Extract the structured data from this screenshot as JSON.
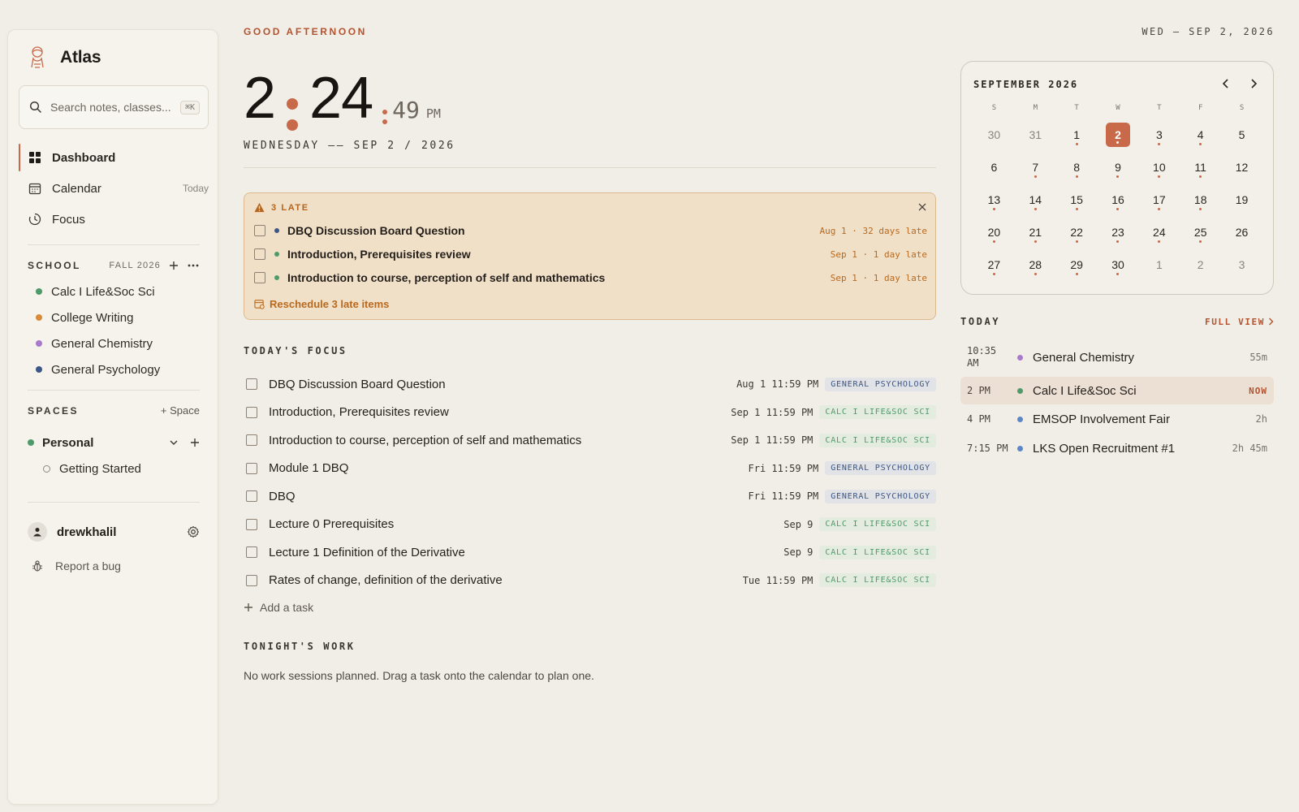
{
  "app": {
    "name": "Atlas"
  },
  "colors": {
    "accent": "#c8694a",
    "calc": "#4f9a6a",
    "writing": "#d88a3a",
    "chemistry": "#a97acc",
    "psychology": "#3c5685",
    "event_blue": "#5b86c8"
  },
  "sidebar": {
    "search": {
      "text": "Search notes, classes...",
      "shortcut": "⌘K"
    },
    "nav": [
      {
        "label": "Dashboard",
        "icon": "grid-icon",
        "active": true
      },
      {
        "label": "Calendar",
        "icon": "calendar-icon",
        "aux": "Today"
      },
      {
        "label": "Focus",
        "icon": "clock-icon"
      }
    ],
    "school": {
      "title": "SCHOOL",
      "term": "FALL 2026",
      "classes": [
        {
          "label": "Calc I Life&Soc Sci",
          "color": "#4f9a6a"
        },
        {
          "label": "College Writing",
          "color": "#d88a3a"
        },
        {
          "label": "General Chemistry",
          "color": "#a97acc"
        },
        {
          "label": "General Psychology",
          "color": "#3c5685"
        }
      ]
    },
    "spaces": {
      "title": "SPACES",
      "add_label": "+ Space",
      "space": {
        "label": "Personal",
        "color": "#4f9a6a"
      },
      "children": [
        {
          "label": "Getting Started"
        }
      ]
    },
    "user": {
      "name": "drewkhalil"
    },
    "report_bug": "Report a bug"
  },
  "main": {
    "greeting": "GOOD AFTERNOON",
    "clock": {
      "hour": "2",
      "minute": "24",
      "second": "49",
      "ampm": "PM"
    },
    "date_line": "WEDNESDAY —— SEP 2 / 2026",
    "late": {
      "header": "3 LATE",
      "items": [
        {
          "title": "DBQ Discussion Board Question",
          "due": "Aug 1 · 32 days late",
          "color": "#3c5685"
        },
        {
          "title": "Introduction, Prerequisites review",
          "due": "Sep 1 · 1 day late",
          "color": "#4f9a6a"
        },
        {
          "title": "Introduction to course, perception of self and mathematics",
          "due": "Sep 1 · 1 day late",
          "color": "#4f9a6a"
        }
      ],
      "reschedule": "Reschedule 3 late items"
    },
    "focus": {
      "title": "TODAY'S FOCUS",
      "tasks": [
        {
          "title": "DBQ Discussion Board Question",
          "due": "Aug 1 11:59 PM",
          "tag": "GENERAL PSYCHOLOGY",
          "kind": "psych"
        },
        {
          "title": "Introduction, Prerequisites review",
          "due": "Sep 1 11:59 PM",
          "tag": "CALC I LIFE&SOC SCI",
          "kind": "calc"
        },
        {
          "title": "Introduction to course, perception of self and mathematics",
          "due": "Sep 1 11:59 PM",
          "tag": "CALC I LIFE&SOC SCI",
          "kind": "calc"
        },
        {
          "title": "Module 1 DBQ",
          "due": "Fri 11:59 PM",
          "tag": "GENERAL PSYCHOLOGY",
          "kind": "psych"
        },
        {
          "title": "DBQ",
          "due": "Fri 11:59 PM",
          "tag": "GENERAL PSYCHOLOGY",
          "kind": "psych"
        },
        {
          "title": "Lecture 0 Prerequisites",
          "due": "Sep 9",
          "tag": "CALC I LIFE&SOC SCI",
          "kind": "calc"
        },
        {
          "title": "Lecture 1 Definition of the Derivative",
          "due": "Sep 9",
          "tag": "CALC I LIFE&SOC SCI",
          "kind": "calc"
        },
        {
          "title": "Rates of change, definition of the derivative",
          "due": "Tue 11:59 PM",
          "tag": "CALC I LIFE&SOC SCI",
          "kind": "calc"
        }
      ],
      "add_task": "Add a task"
    },
    "tonight": {
      "title": "TONIGHT'S WORK",
      "empty": "No work sessions planned. Drag a task onto the calendar to plan one."
    }
  },
  "right": {
    "date": "WED — SEP 2, 2026",
    "calendar": {
      "title": "SEPTEMBER 2026",
      "weekdays": [
        "S",
        "M",
        "T",
        "W",
        "T",
        "F",
        "S"
      ],
      "days": [
        {
          "n": "30",
          "muted": true,
          "ev": false
        },
        {
          "n": "31",
          "muted": true,
          "ev": false
        },
        {
          "n": "1",
          "ev": true
        },
        {
          "n": "2",
          "ev": true,
          "selected": true
        },
        {
          "n": "3",
          "ev": true
        },
        {
          "n": "4",
          "ev": true
        },
        {
          "n": "5",
          "ev": false
        },
        {
          "n": "6",
          "ev": false
        },
        {
          "n": "7",
          "ev": true
        },
        {
          "n": "8",
          "ev": true
        },
        {
          "n": "9",
          "ev": true
        },
        {
          "n": "10",
          "ev": true
        },
        {
          "n": "11",
          "ev": true
        },
        {
          "n": "12",
          "ev": false
        },
        {
          "n": "13",
          "ev": true
        },
        {
          "n": "14",
          "ev": true
        },
        {
          "n": "15",
          "ev": true
        },
        {
          "n": "16",
          "ev": true
        },
        {
          "n": "17",
          "ev": true
        },
        {
          "n": "18",
          "ev": true
        },
        {
          "n": "19",
          "ev": false
        },
        {
          "n": "20",
          "ev": true
        },
        {
          "n": "21",
          "ev": true
        },
        {
          "n": "22",
          "ev": true
        },
        {
          "n": "23",
          "ev": true
        },
        {
          "n": "24",
          "ev": true
        },
        {
          "n": "25",
          "ev": true
        },
        {
          "n": "26",
          "ev": false
        },
        {
          "n": "27",
          "ev": true
        },
        {
          "n": "28",
          "ev": true
        },
        {
          "n": "29",
          "ev": true
        },
        {
          "n": "30",
          "ev": true
        },
        {
          "n": "1",
          "muted": true,
          "ev": false
        },
        {
          "n": "2",
          "muted": true,
          "ev": false
        },
        {
          "n": "3",
          "muted": true,
          "ev": false
        }
      ]
    },
    "today": {
      "title": "TODAY",
      "full_view": "FULL VIEW",
      "events": [
        {
          "time": "10:35\nAM",
          "title": "General Chemistry",
          "dur": "55m",
          "color": "#a97acc",
          "now": false
        },
        {
          "time": "2 PM",
          "title": "Calc I Life&Soc Sci",
          "dur": "NOW",
          "color": "#4f9a6a",
          "now": true
        },
        {
          "time": "4 PM",
          "title": "EMSOP Involvement Fair",
          "dur": "2h",
          "color": "#5b86c8",
          "now": false
        },
        {
          "time": "7:15 PM",
          "title": "LKS Open Recruitment #1",
          "dur": "2h 45m",
          "color": "#5b86c8",
          "now": false
        }
      ]
    }
  }
}
